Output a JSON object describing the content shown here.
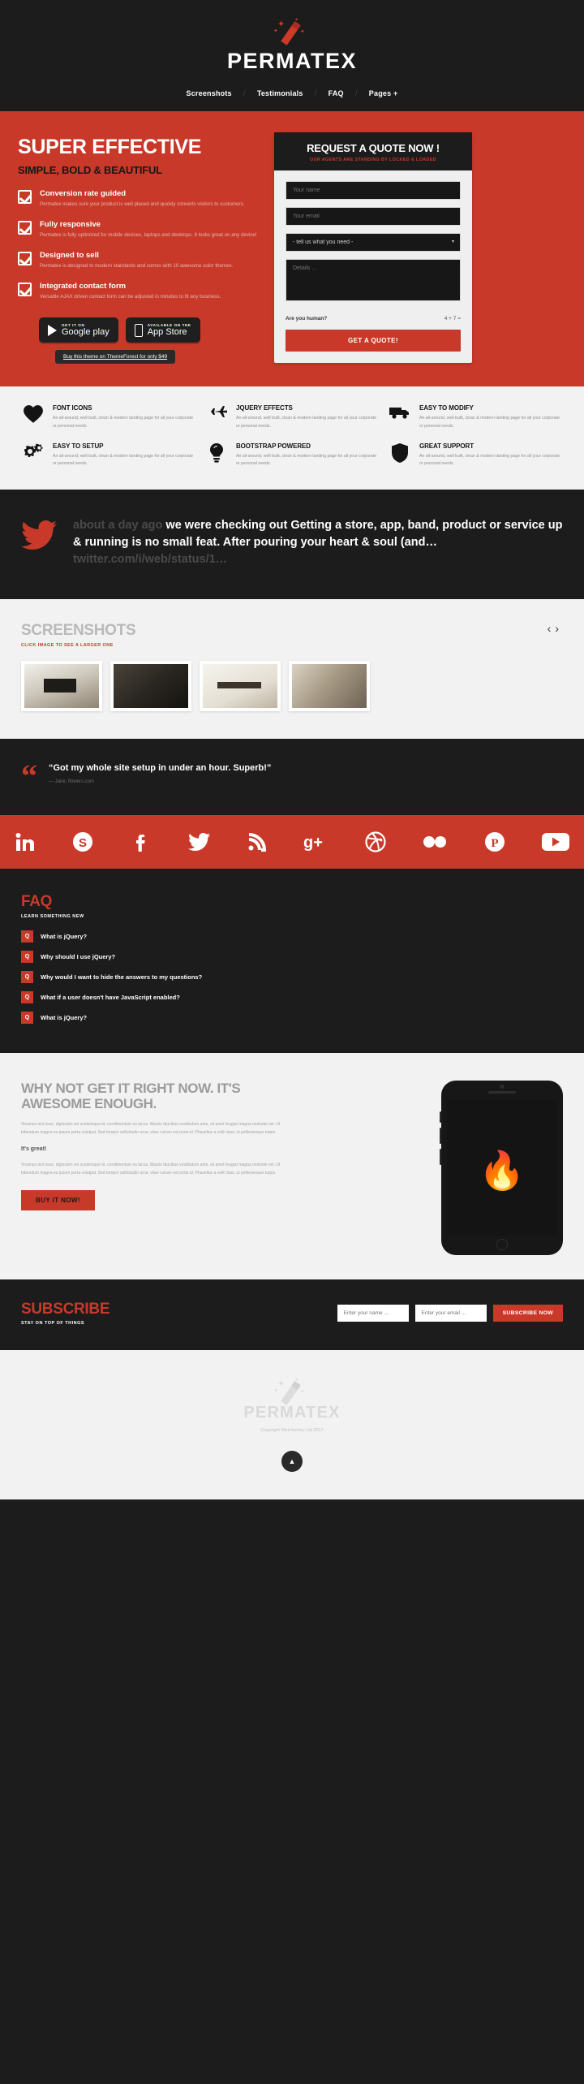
{
  "brand": {
    "name": "PERMATEX",
    "icon": "magic-wand-icon",
    "accent": "#c9392a",
    "dark": "#1c1c1c"
  },
  "nav": {
    "items": [
      {
        "label": "Screenshots"
      },
      {
        "label": "Testimonials"
      },
      {
        "label": "FAQ"
      },
      {
        "label": "Pages +"
      }
    ]
  },
  "hero": {
    "title": "SUPER EFFECTIVE",
    "subtitle": "SIMPLE, BOLD & BEAUTIFUL",
    "features": [
      {
        "title": "Conversion rate guided",
        "text": "Permatex makes sure your product is well placed and quickly converts visitors to customers."
      },
      {
        "title": "Fully responsive",
        "text": "Permatex is fully optimized for mobile devices, laptops and desktops. It looks great on any device!"
      },
      {
        "title": "Designed to sell",
        "text": "Permatex is designed to modern standards and comes with 10 awesome color themes."
      },
      {
        "title": "Integrated contact form",
        "text": "Versatile AJAX driven contact form can be adjusted in minutes to fit any business."
      }
    ],
    "stores": [
      {
        "small": "GET IT ON",
        "big": "Google play",
        "icon": "google-play-icon"
      },
      {
        "small": "AVAILABLE ON THE",
        "big": "App Store",
        "icon": "apple-app-store-icon"
      }
    ],
    "theme_button": "Buy this theme on ThemeForest for only $49"
  },
  "quote": {
    "title": "REQUEST A QUOTE NOW !",
    "subtitle": "OUR AGENTS ARE STANDING BY LOCKED & LOADED",
    "name_placeholder": "Your name",
    "email_placeholder": "Your email",
    "select_value": "- tell us what you need -",
    "details_placeholder": "Details ...",
    "human_label": "Are you human?",
    "human_equation": "4 + 7 =",
    "submit_label": "GET A QUOTE!"
  },
  "icon_features": {
    "body": "An all-around, well built, clean & modern landing page for all your corporate or personal needs.",
    "items": [
      {
        "title": "FONT ICONS",
        "icon": "heart-icon",
        "glyph": "♥"
      },
      {
        "title": "JQUERY EFFECTS",
        "icon": "jet-plane-icon",
        "glyph": "✈"
      },
      {
        "title": "EASY TO MODIFY",
        "icon": "truck-icon",
        "glyph": "⛟"
      },
      {
        "title": "EASY TO SETUP",
        "icon": "gears-icon",
        "glyph": "⚙"
      },
      {
        "title": "BOOTSTRAP POWERED",
        "icon": "lightbulb-icon",
        "glyph": "◯"
      },
      {
        "title": "GREAT SUPPORT",
        "icon": "shield-icon",
        "glyph": "⬟"
      }
    ]
  },
  "twitter": {
    "icon": "twitter-bird-icon",
    "time": "about a day ago",
    "text": "we were checking out  Getting a store, app, band, product or service up & running is no small feat. After pouring your heart & soul (and…",
    "link": "twitter.com/i/web/status/1…"
  },
  "screenshots": {
    "title": "SCREENSHOTS",
    "subtitle": "CLICK IMAGE TO SEE A LARGER ONE",
    "prev_icon": "chevron-left-icon",
    "next_icon": "chevron-right-icon",
    "items": [
      {
        "alt": "Business card box photo"
      },
      {
        "alt": "Stacked gold foil cards photo"
      },
      {
        "alt": "Rockable book cover photo"
      },
      {
        "alt": "Scattered printed cards photo"
      }
    ]
  },
  "testimonial": {
    "quote": "“Got my whole site setup in under an hour. Superb!”",
    "author": "— Jane, flowers.com"
  },
  "social": {
    "items": [
      {
        "name": "linkedin-icon",
        "glyph": "in"
      },
      {
        "name": "skype-icon",
        "glyph": "S"
      },
      {
        "name": "facebook-icon",
        "glyph": "f"
      },
      {
        "name": "twitter-icon",
        "glyph": "t"
      },
      {
        "name": "rss-icon",
        "glyph": "ʀ"
      },
      {
        "name": "google-plus-icon",
        "glyph": "g+"
      },
      {
        "name": "dribbble-icon",
        "glyph": "◎"
      },
      {
        "name": "flickr-icon",
        "glyph": "●●"
      },
      {
        "name": "pinterest-icon",
        "glyph": "P"
      },
      {
        "name": "youtube-icon",
        "glyph": "▶"
      }
    ]
  },
  "faq": {
    "title": "FAQ",
    "subtitle": "LEARN SOMETHING NEW",
    "badge": "Q",
    "questions": [
      "What is jQuery?",
      "Why should I use jQuery?",
      "Why would I want to hide the answers to my questions?",
      "What if a user doesn't have JavaScript enabled?",
      "What is jQuery?"
    ]
  },
  "cta": {
    "title": "WHY NOT GET IT RIGHT NOW. IT'S AWESOME ENOUGH.",
    "paragraph1": "Vivamus nisl risus, dignissim vel scelerisque id, condimentum eu lacus. Mauris faucibus vestibulum ante, sit amet feugiat magna molestie vel. Ut bibendum magna eu ipsum porta volutpat. Sed tempor sollicitudin urna, vitae rutrum est porta id. Phasellus a velit risus, ut pellentesque turpis.",
    "heading2": "It's great!",
    "paragraph2": "Vivamus nisl risus, dignissim vel scelerisque id, condimentum eu lacus. Mauris faucibus vestibulum ante, sit amet feugiat magna molestie vel. Ut bibendum magna eu ipsum porta volutpat. Sed tempor sollicitudin urna, vitae rutrum est porta id. Phasellus a velit risus, ut pellentesque turpis.",
    "button": "BUY IT NOW!",
    "device_icon": "iphone-mockup-icon"
  },
  "subscribe": {
    "title": "SUBSCRIBE",
    "subtitle": "STAY ON TOP OF THINGS",
    "name_placeholder": "Enter your name ...",
    "email_placeholder": "Enter your email ...",
    "button": "SUBSCRIBE NOW"
  },
  "footer": {
    "name": "PERMATEX",
    "copyright": "Copyright Web factory Ltd 2017",
    "to_top_icon": "arrow-up-icon",
    "to_top_glyph": "▲"
  }
}
